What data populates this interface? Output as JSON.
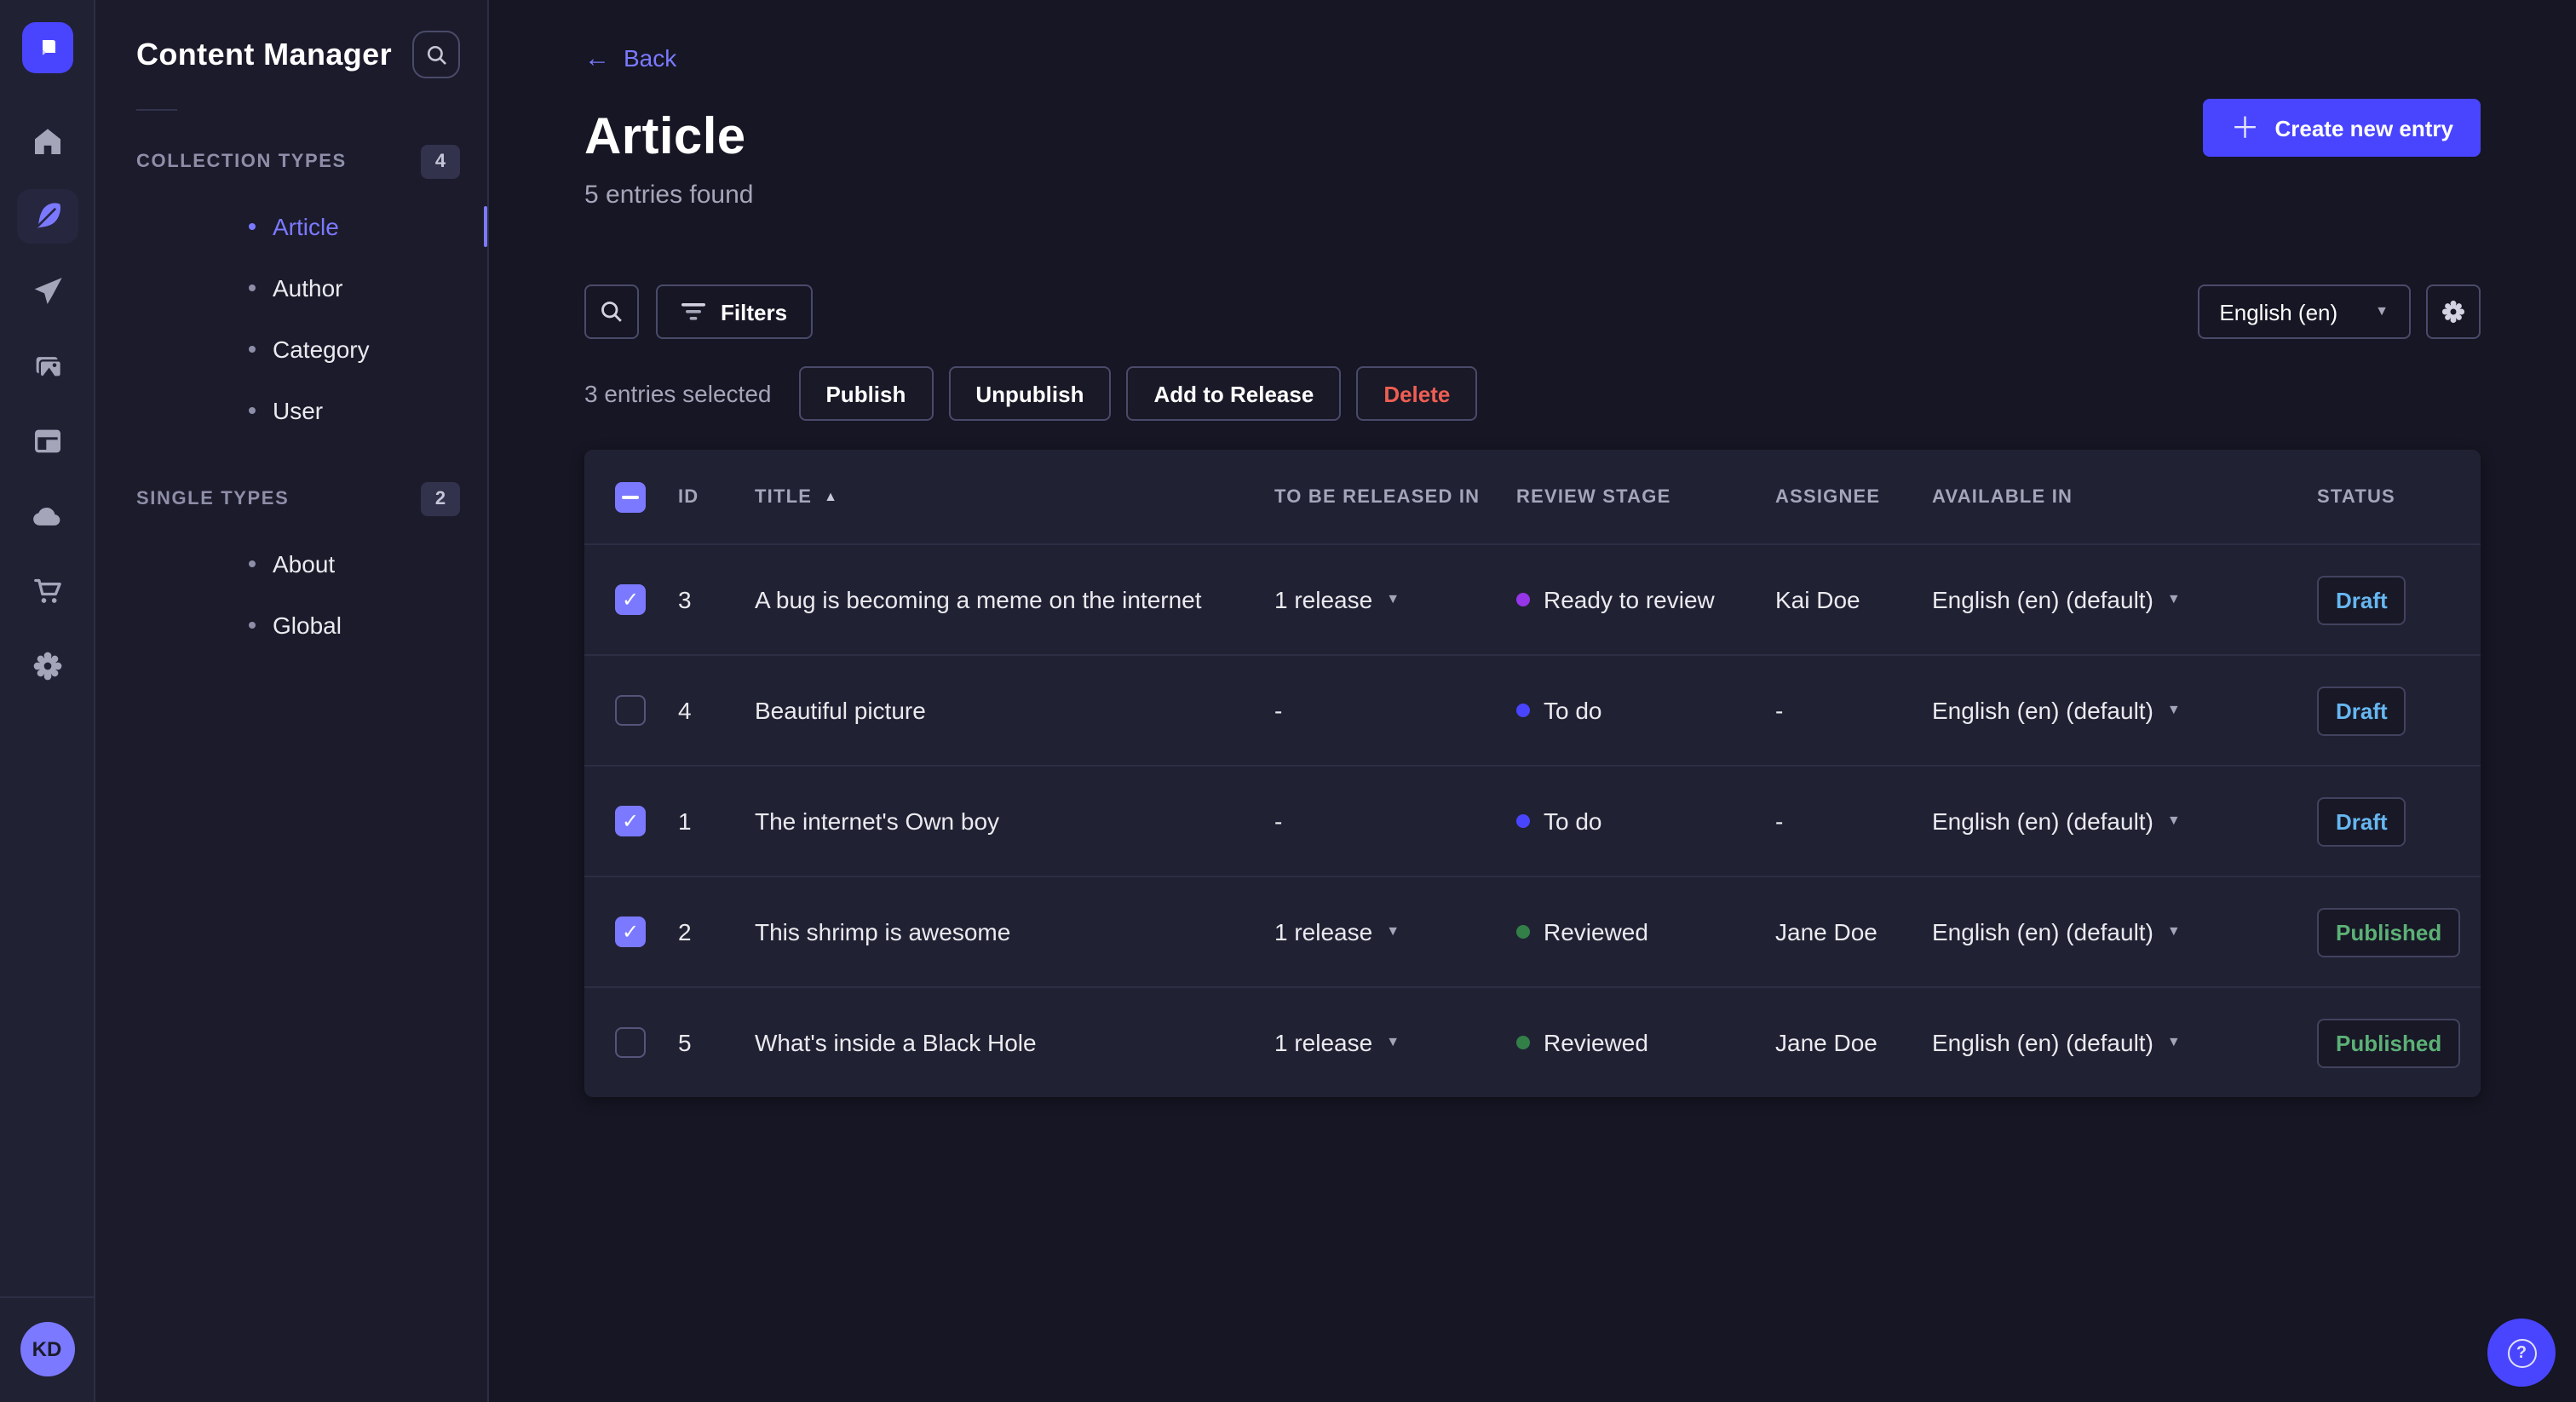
{
  "sidebar": {
    "title": "Content Manager",
    "sections": [
      {
        "label": "COLLECTION TYPES",
        "count": "4",
        "items": [
          {
            "label": "Article",
            "active": true
          },
          {
            "label": "Author",
            "active": false
          },
          {
            "label": "Category",
            "active": false
          },
          {
            "label": "User",
            "active": false
          }
        ]
      },
      {
        "label": "SINGLE TYPES",
        "count": "2",
        "items": [
          {
            "label": "About",
            "active": false
          },
          {
            "label": "Global",
            "active": false
          }
        ]
      }
    ]
  },
  "nav_icons": [
    "home-icon",
    "feather-icon",
    "send-icon",
    "images-icon",
    "layout-icon",
    "cloud-icon",
    "cart-icon",
    "gear-icon"
  ],
  "header": {
    "back_label": "Back",
    "title": "Article",
    "subtitle": "5 entries found",
    "create_label": "Create new entry"
  },
  "toolbar": {
    "filters_label": "Filters",
    "locale_value": "English (en)"
  },
  "selection": {
    "text": "3 entries selected",
    "publish_label": "Publish",
    "unpublish_label": "Unpublish",
    "add_to_release_label": "Add to Release",
    "delete_label": "Delete"
  },
  "table": {
    "headers": {
      "id": "ID",
      "title": "TITLE",
      "release": "TO BE RELEASED IN",
      "review_stage": "REVIEW STAGE",
      "assignee": "ASSIGNEE",
      "available_in": "AVAILABLE IN",
      "status": "STATUS"
    },
    "rows": [
      {
        "checked": true,
        "id": "3",
        "title": "A bug is becoming a meme on the internet",
        "release": "1 release",
        "stage": "Ready to review",
        "stage_color": "#9736e8",
        "assignee": "Kai Doe",
        "locale": "English (en) (default)",
        "status": "Draft"
      },
      {
        "checked": false,
        "id": "4",
        "title": "Beautiful picture",
        "release": "-",
        "stage": "To do",
        "stage_color": "#4945ff",
        "assignee": "-",
        "locale": "English (en) (default)",
        "status": "Draft"
      },
      {
        "checked": true,
        "id": "1",
        "title": "The internet's Own boy",
        "release": "-",
        "stage": "To do",
        "stage_color": "#4945ff",
        "assignee": "-",
        "locale": "English (en) (default)",
        "status": "Draft"
      },
      {
        "checked": true,
        "id": "2",
        "title": "This shrimp is awesome",
        "release": "1 release",
        "stage": "Reviewed",
        "stage_color": "#328048",
        "assignee": "Jane Doe",
        "locale": "English (en) (default)",
        "status": "Published"
      },
      {
        "checked": false,
        "id": "5",
        "title": "What's inside a Black Hole",
        "release": "1 release",
        "stage": "Reviewed",
        "stage_color": "#328048",
        "assignee": "Jane Doe",
        "locale": "English (en) (default)",
        "status": "Published"
      }
    ]
  },
  "user": {
    "initials": "KD"
  },
  "colors": {
    "accent": "#4945ff",
    "checkbox": "#7b79ff",
    "draft_text": "#66b7f1",
    "published_text": "#5cb176",
    "danger_text": "#ee5e52"
  }
}
